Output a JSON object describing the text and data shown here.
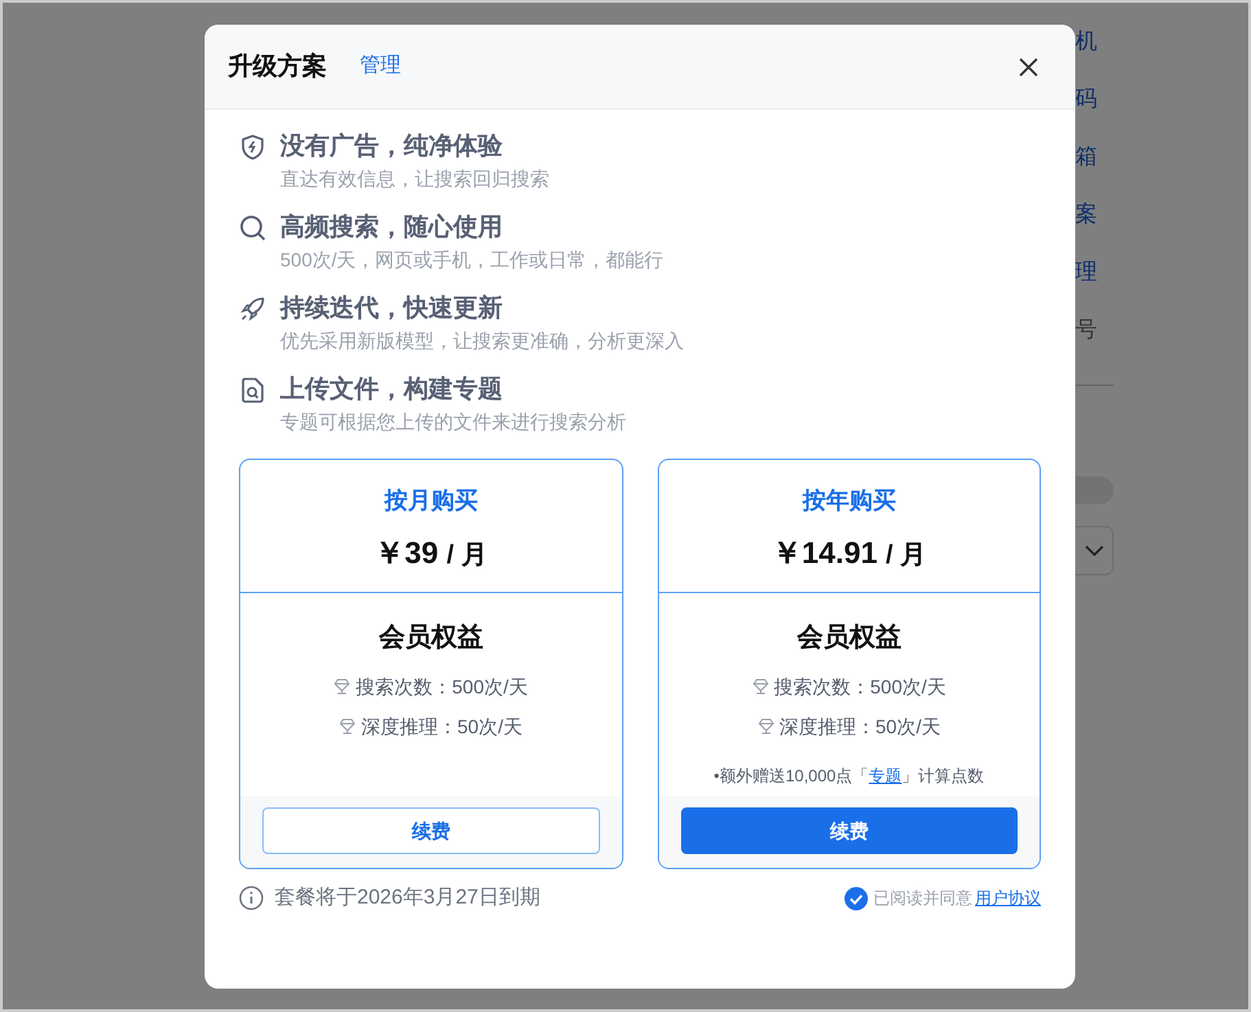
{
  "background_page": {
    "items": [
      {
        "text": "机",
        "kind": "link"
      },
      {
        "text": "码",
        "kind": "link"
      },
      {
        "text": "箱",
        "kind": "link"
      },
      {
        "text": "案",
        "kind": "link"
      },
      {
        "text": "理",
        "kind": "link"
      },
      {
        "text": "号",
        "kind": "text"
      }
    ],
    "toggle": {
      "on": false
    }
  },
  "modal": {
    "title": "升级方案",
    "manage_link": "管理",
    "features": [
      {
        "kind": "shield",
        "title": "没有广告，纯净体验",
        "subtitle": "直达有效信息，让搜索回归搜索"
      },
      {
        "kind": "search",
        "title": "高频搜索，随心使用",
        "subtitle": "500次/天，网页或手机，工作或日常，都能行"
      },
      {
        "kind": "rocket",
        "title": "持续迭代，快速更新",
        "subtitle": "优先采用新版模型，让搜索更准确，分析更深入"
      },
      {
        "kind": "file",
        "title": "上传文件，构建专题",
        "subtitle": "专题可根据您上传的文件来进行搜索分析"
      }
    ],
    "plans": [
      {
        "title": "按月购买",
        "price": "￥39",
        "unit": "/ 月",
        "benefits_title": "会员权益",
        "benefits": [
          "搜索次数：500次/天",
          "深度推理：50次/天"
        ],
        "button": "续费",
        "selected": false
      },
      {
        "title": "按年购买",
        "price": "￥14.91",
        "unit": "/ 月",
        "benefits_title": "会员权益",
        "benefits": [
          "搜索次数：500次/天",
          "深度推理：50次/天"
        ],
        "note": {
          "before": "•额外赠送10,000点「",
          "link": "专题",
          "after": "」计算点数"
        },
        "button": "续费",
        "selected": true
      }
    ],
    "expiry": "套餐将于2026年3月27日到期",
    "agreement": {
      "checked": true,
      "text": "已阅读并同意",
      "link": "用户协议"
    }
  }
}
